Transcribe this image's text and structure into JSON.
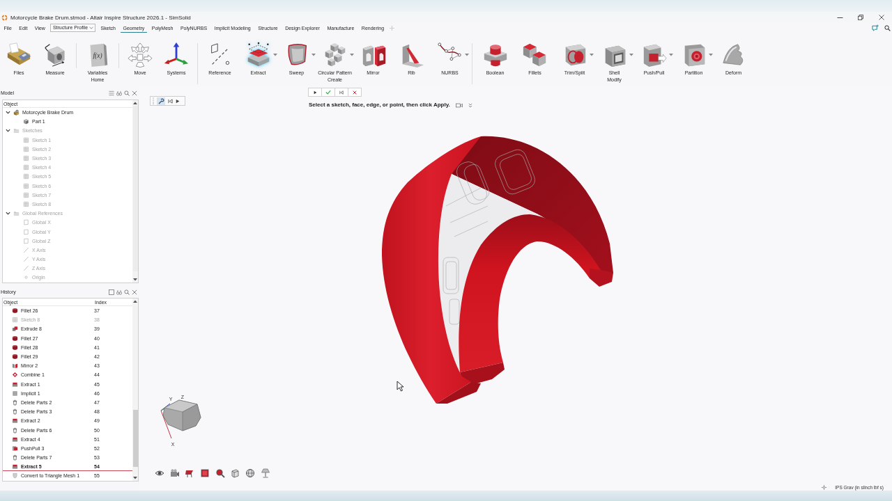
{
  "window": {
    "title": "Motorcycle Brake Drum.stmod - Altair Inspire Structure 2026.1 - SimSolid"
  },
  "menu_bar": [
    {
      "label": "File",
      "kind": "menu",
      "selected": false
    },
    {
      "label": "Edit",
      "kind": "menu",
      "selected": false
    },
    {
      "label": "View",
      "kind": "menu",
      "selected": false
    },
    {
      "label": "Structure Profile",
      "kind": "dropdown",
      "selected": false
    },
    {
      "label": "Sketch",
      "kind": "tab",
      "selected": false
    },
    {
      "label": "Geometry",
      "kind": "tab",
      "selected": true
    },
    {
      "label": "PolyMesh",
      "kind": "tab",
      "selected": false
    },
    {
      "label": "PolyNURBS",
      "kind": "tab",
      "selected": false
    },
    {
      "label": "Implicit Modeling",
      "kind": "tab",
      "selected": false
    },
    {
      "label": "Structure",
      "kind": "tab",
      "selected": false
    },
    {
      "label": "Design Explorer",
      "kind": "tab",
      "selected": false
    },
    {
      "label": "Manufacture",
      "kind": "tab",
      "selected": false
    },
    {
      "label": "Rendering",
      "kind": "tab",
      "selected": false
    }
  ],
  "ribbon": [
    {
      "label": "Home",
      "sections": [
        [
          {
            "label": "Files",
            "kind": "files",
            "menu": false,
            "selected": false
          },
          {
            "label": "Measure",
            "kind": "measure",
            "menu": false,
            "selected": false
          }
        ],
        [
          {
            "label": "Variables",
            "kind": "variables",
            "glyph": "f(x)",
            "menu": false,
            "selected": false
          }
        ],
        [
          {
            "label": "Move",
            "kind": "move",
            "menu": false,
            "selected": false
          },
          {
            "label": "Systems",
            "kind": "systems",
            "menu": false,
            "selected": false
          }
        ]
      ]
    },
    {
      "label": "Create",
      "sections": [
        [
          {
            "label": "Reference",
            "kind": "reference",
            "menu": false,
            "selected": false
          },
          {
            "label": "Extract",
            "kind": "extract",
            "menu": true,
            "selected": true
          },
          {
            "label": "Sweep",
            "kind": "sweep",
            "menu": true,
            "selected": false
          },
          {
            "label": "Circular Pattern",
            "kind": "pattern",
            "menu": true,
            "selected": false
          },
          {
            "label": "Mirror",
            "kind": "mirror",
            "menu": false,
            "selected": false
          },
          {
            "label": "Rib",
            "kind": "rib",
            "menu": false,
            "selected": false
          },
          {
            "label": "NURBS",
            "kind": "nurbs",
            "menu": true,
            "selected": false
          }
        ]
      ]
    },
    {
      "label": "Modify",
      "sections": [
        [
          {
            "label": "Boolean",
            "kind": "boolean",
            "menu": false,
            "selected": false
          },
          {
            "label": "Fillets",
            "kind": "fillets",
            "menu": false,
            "selected": false
          },
          {
            "label": "Trim/Split",
            "kind": "trim",
            "menu": true,
            "selected": false
          },
          {
            "label": "Shell",
            "kind": "shell",
            "menu": true,
            "selected": false
          },
          {
            "label": "Push/Pull",
            "kind": "pushpull",
            "menu": true,
            "selected": false
          },
          {
            "label": "Partition",
            "kind": "partition",
            "menu": true,
            "selected": false
          },
          {
            "label": "Deform",
            "kind": "deform",
            "menu": false,
            "selected": false
          }
        ]
      ]
    }
  ],
  "model": {
    "title": "Model",
    "column": "Object",
    "tree": [
      {
        "label": "Motorcycle Brake Drum",
        "kind": "assembly",
        "dimmed": false,
        "expanded": true,
        "children": [
          {
            "label": "Part 1",
            "kind": "part",
            "dimmed": false
          }
        ]
      },
      {
        "label": "Sketches",
        "kind": "folder",
        "dimmed": true,
        "expanded": true,
        "children": [
          {
            "label": "Sketch 1",
            "kind": "sketch",
            "dimmed": true
          },
          {
            "label": "Sketch 2",
            "kind": "sketch",
            "dimmed": true
          },
          {
            "label": "Sketch 3",
            "kind": "sketch",
            "dimmed": true
          },
          {
            "label": "Sketch 4",
            "kind": "sketch",
            "dimmed": true
          },
          {
            "label": "Sketch 5",
            "kind": "sketch",
            "dimmed": true
          },
          {
            "label": "Sketch 6",
            "kind": "sketch",
            "dimmed": true
          },
          {
            "label": "Sketch 7",
            "kind": "sketch",
            "dimmed": true
          },
          {
            "label": "Sketch 8",
            "kind": "sketch",
            "dimmed": true
          }
        ]
      },
      {
        "label": "Global References",
        "kind": "folder",
        "dimmed": true,
        "expanded": true,
        "children": [
          {
            "label": "Global X",
            "kind": "plane",
            "dimmed": true
          },
          {
            "label": "Global Y",
            "kind": "plane",
            "dimmed": true
          },
          {
            "label": "Global Z",
            "kind": "plane",
            "dimmed": true
          },
          {
            "label": "X Axis",
            "kind": "axis",
            "dimmed": true
          },
          {
            "label": "Y Axis",
            "kind": "axis",
            "dimmed": true
          },
          {
            "label": "Z Axis",
            "kind": "axis",
            "dimmed": true
          },
          {
            "label": "Origin",
            "kind": "point",
            "dimmed": true
          }
        ]
      }
    ]
  },
  "history": {
    "title": "History",
    "columns": [
      "Object",
      "Index"
    ],
    "rows": [
      {
        "name": "Fillet 26",
        "index": "37",
        "kind": "fillet",
        "dimmed": false,
        "current": false
      },
      {
        "name": "Sketch 8",
        "index": "38",
        "kind": "sketch",
        "dimmed": true,
        "current": false
      },
      {
        "name": "Extrude 8",
        "index": "39",
        "kind": "extrude",
        "dimmed": false,
        "current": false
      },
      {
        "name": "Fillet 27",
        "index": "40",
        "kind": "fillet",
        "dimmed": false,
        "current": false
      },
      {
        "name": "Fillet 28",
        "index": "41",
        "kind": "fillet",
        "dimmed": false,
        "current": false
      },
      {
        "name": "Fillet 29",
        "index": "42",
        "kind": "fillet",
        "dimmed": false,
        "current": false
      },
      {
        "name": "Mirror 2",
        "index": "43",
        "kind": "mirror",
        "dimmed": false,
        "current": false
      },
      {
        "name": "Combine 1",
        "index": "44",
        "kind": "combine",
        "dimmed": false,
        "current": false
      },
      {
        "name": "Extract 1",
        "index": "45",
        "kind": "extract",
        "dimmed": false,
        "current": false
      },
      {
        "name": "Implicit 1",
        "index": "46",
        "kind": "implicit",
        "dimmed": false,
        "current": false
      },
      {
        "name": "Delete Parts 2",
        "index": "47",
        "kind": "delete",
        "dimmed": false,
        "current": false
      },
      {
        "name": "Delete Parts 3",
        "index": "48",
        "kind": "delete",
        "dimmed": false,
        "current": false
      },
      {
        "name": "Extract 2",
        "index": "49",
        "kind": "extract",
        "dimmed": false,
        "current": false
      },
      {
        "name": "Delete Parts 6",
        "index": "50",
        "kind": "delete",
        "dimmed": false,
        "current": false
      },
      {
        "name": "Extract 4",
        "index": "51",
        "kind": "extract",
        "dimmed": false,
        "current": false
      },
      {
        "name": "PushPull 3",
        "index": "52",
        "kind": "pushpull",
        "dimmed": false,
        "current": false
      },
      {
        "name": "Delete Parts 7",
        "index": "53",
        "kind": "delete",
        "dimmed": false,
        "current": false
      },
      {
        "name": "Extract 5",
        "index": "54",
        "kind": "extract",
        "dimmed": false,
        "current": true
      },
      {
        "name": "Convert to Triangle Mesh 1",
        "index": "55",
        "kind": "mesh",
        "dimmed": false,
        "current": false
      }
    ]
  },
  "viewport": {
    "prompt": "Select a sketch, face, edge, or point, then click Apply.",
    "axis_labels": [
      "Y",
      "Z",
      "X"
    ]
  },
  "status_bar": {
    "units": "IPS Grav (in slinch lbf s)"
  }
}
